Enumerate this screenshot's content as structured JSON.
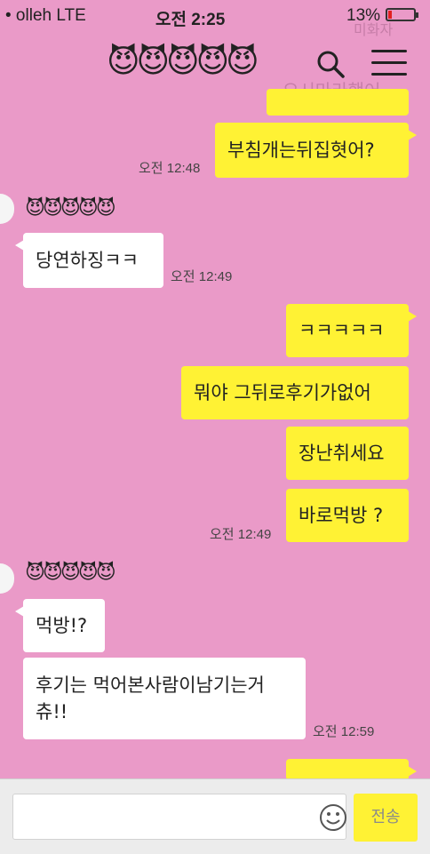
{
  "status_bar": {
    "carrier": "• olleh  LTE",
    "time": "오전 2:25",
    "battery_percent": "13%",
    "battery_level": 0.13,
    "battery_color": "#e02020"
  },
  "header": {
    "title": "😈😈😈😈😈",
    "search_icon": "search-icon",
    "menu_icon": "menu-icon"
  },
  "ghost_text": {
    "top_right": "미화자",
    "behind_header": "오시마라했어"
  },
  "messages": [
    {
      "side": "me",
      "text": "",
      "note": "partial bubble cut off at top"
    },
    {
      "side": "me",
      "text": "부침개는뒤집혓어?",
      "time": "오전 12:48"
    },
    {
      "side": "them",
      "sender": "😈😈😈😈😈",
      "text": "당연하징ㅋㅋ",
      "time": "오전 12:49"
    },
    {
      "side": "me",
      "text": "ㅋㅋㅋㅋㅋ"
    },
    {
      "side": "me",
      "text": "뭐야 그뒤로후기가없어"
    },
    {
      "side": "me",
      "text": "장난취세요"
    },
    {
      "side": "me",
      "text": "바로먹방 ?",
      "time": "오전 12:49"
    },
    {
      "side": "them",
      "sender": "😈😈😈😈😈",
      "text": "먹방!?"
    },
    {
      "side": "them",
      "text_line1": "후기는 먹어본사람이남기는거",
      "text_line2": "츄!!",
      "time": "오전 12:59"
    }
  ],
  "input": {
    "placeholder": "",
    "emoji_icon": "smiley-icon",
    "send_label": "전송"
  },
  "colors": {
    "background": "#ea9ac8",
    "my_bubble": "#fff234",
    "their_bubble": "#ffffff"
  }
}
